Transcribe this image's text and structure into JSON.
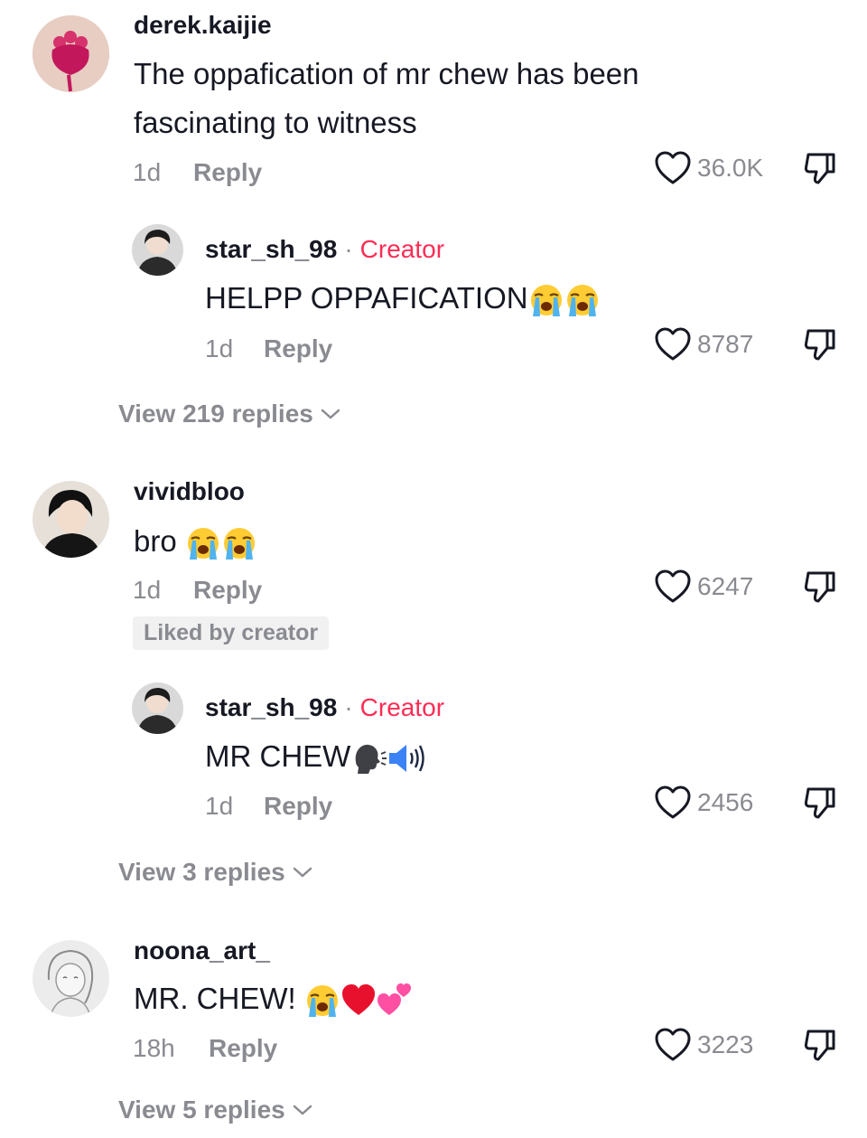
{
  "comments": [
    {
      "username": "derek.kaijie",
      "text_line1": "The oppafication of mr chew has been",
      "text_line2": "fascinating to witness",
      "time": "1d",
      "reply_label": "Reply",
      "likes": "36.0K",
      "reply": {
        "username": "star_sh_98",
        "badge": "Creator",
        "separator": "·",
        "text": "HELPP OPPAFICATION",
        "emojis": [
          "loudly-crying-face",
          "loudly-crying-face"
        ],
        "time": "1d",
        "reply_label": "Reply",
        "likes": "8787"
      },
      "view_replies": "View 219 replies"
    },
    {
      "username": "vividbloo",
      "text": "bro ",
      "emojis": [
        "loudly-crying-face",
        "loudly-crying-face"
      ],
      "time": "1d",
      "reply_label": "Reply",
      "likes": "6247",
      "liked_by": "Liked by creator",
      "reply": {
        "username": "star_sh_98",
        "badge": "Creator",
        "separator": "·",
        "text": "MR CHEW",
        "emojis": [
          "speaking-head",
          "speaker-loud"
        ],
        "time": "1d",
        "reply_label": "Reply",
        "likes": "2456"
      },
      "view_replies": "View 3 replies"
    },
    {
      "username": "noona_art_",
      "text": "MR. CHEW! ",
      "emojis": [
        "loudly-crying-face",
        "red-heart",
        "two-hearts"
      ],
      "time": "18h",
      "reply_label": "Reply",
      "likes": "3223",
      "view_replies": "View 5 replies"
    }
  ],
  "colors": {
    "creator": "#fe2c55",
    "muted": "#8a8b91",
    "text": "#161823"
  }
}
